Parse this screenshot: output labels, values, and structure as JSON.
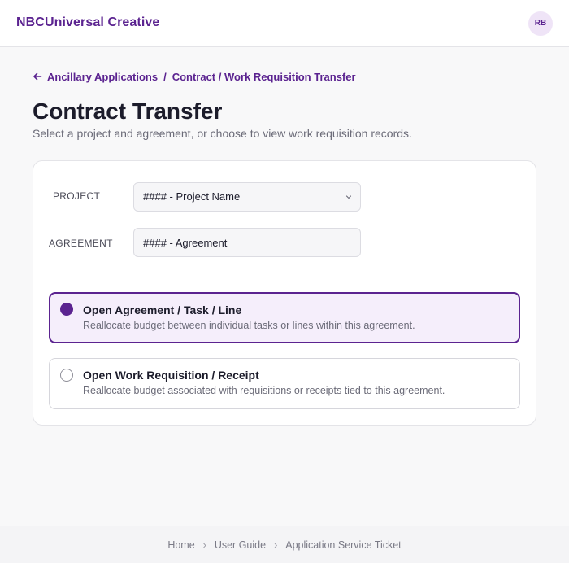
{
  "app": {
    "brand": "NBCUniversal Creative",
    "avatar_initials": "RB"
  },
  "breadcrumb": {
    "back_icon": "arrow-left-icon",
    "parent": "Ancillary Applications",
    "separator": "/",
    "current": "Contract / Work Requisition Transfer"
  },
  "page": {
    "title": "Contract Transfer",
    "subtitle": "Select a project and agreement, or choose to view work requisition records."
  },
  "form": {
    "project_label": "PROJECT",
    "project_value": "#### - Project Name",
    "agreement_label": "AGREEMENT",
    "agreement_value": "#### - Agreement"
  },
  "options": [
    {
      "title": "Open Agreement / Task / Line",
      "description": "Reallocate budget between individual tasks or lines within this agreement.",
      "selected": true
    },
    {
      "title": "Open Work Requisition / Receipt",
      "description": "Reallocate budget associated with requisitions or receipts tied to this agreement.",
      "selected": false
    }
  ],
  "footer": {
    "links": [
      "Home",
      "User Guide",
      "Application Service Ticket"
    ],
    "separator": "›"
  },
  "colors": {
    "accent": "#5b2390",
    "accent_bg": "#f5eefb",
    "page_bg": "#f8f8f9"
  }
}
